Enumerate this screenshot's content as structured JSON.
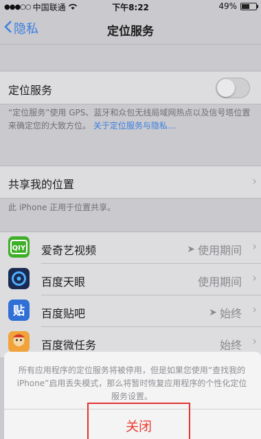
{
  "status_bar": {
    "carrier": "中国联通",
    "time": "下午8:22",
    "battery": "49%"
  },
  "nav": {
    "back_label": "隐私",
    "title": "定位服务"
  },
  "location_services": {
    "label": "定位服务",
    "enabled": false,
    "description": "“定位服务”使用 GPS、蓝牙和众包无线局域网热点以及信号塔位置来确定您的大致方位。",
    "link": "关于定位服务与隐私…"
  },
  "share_location": {
    "label": "共享我的位置",
    "footer": "此 iPhone 正用于位置共享。"
  },
  "apps": [
    {
      "name": "爱奇艺视频",
      "status": "使用期间",
      "arrow": true,
      "icon": "iqiyi-icon",
      "color": "#3fae29"
    },
    {
      "name": "百度天眼",
      "status": "使用期间",
      "arrow": false,
      "icon": "baidu-tianyan-icon",
      "color": "#1a2a52"
    },
    {
      "name": "百度贴吧",
      "status": "始终",
      "arrow": true,
      "icon": "baidu-tieba-icon",
      "color": "#2f6fd6"
    },
    {
      "name": "百度微任务",
      "status": "始终",
      "arrow": false,
      "icon": "baidu-weirenwu-icon",
      "color": "#f0a23b"
    }
  ],
  "dialog": {
    "message": "所有应用程序的定位服务将被停用，但是如果您使用“查找我的 iPhone”启用丢失模式，那么将暂时恢复应用程序的个性化定位服务设置。",
    "close_label": "关闭"
  }
}
